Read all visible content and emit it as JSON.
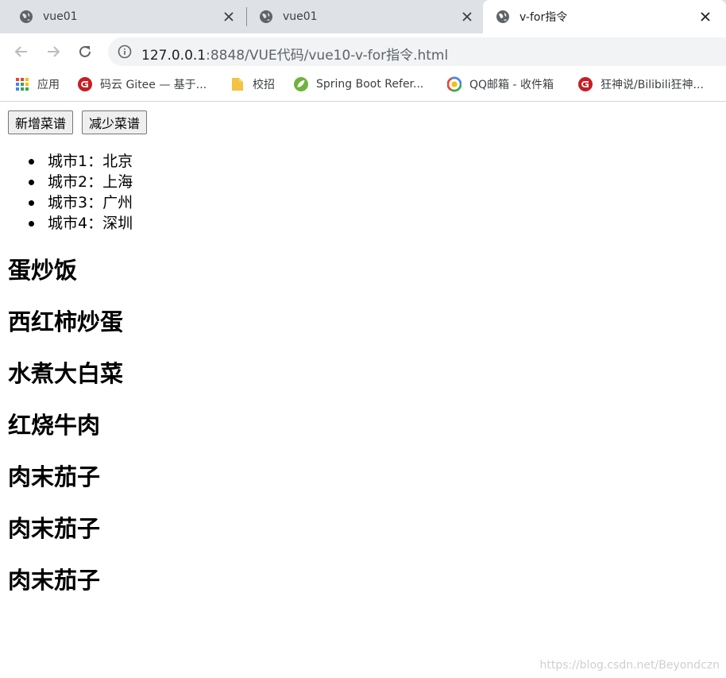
{
  "browser": {
    "tabs": [
      {
        "title": "vue01",
        "active": false
      },
      {
        "title": "vue01",
        "active": false
      },
      {
        "title": "v-for指令",
        "active": true
      }
    ],
    "url_host": "127.0.0.1",
    "url_rest": ":8848/VUE代码/vue10-v-for指令.html",
    "bookmarks": [
      {
        "label": "应用",
        "icon": "apps-grid-icon"
      },
      {
        "label": "码云 Gitee — 基于...",
        "icon": "gitee-icon"
      },
      {
        "label": "校招",
        "icon": "folder-icon"
      },
      {
        "label": "Spring Boot Refer...",
        "icon": "spring-icon"
      },
      {
        "label": "QQ邮箱 - 收件箱",
        "icon": "qq-mail-icon"
      },
      {
        "label": "狂神说/Bilibili狂神...",
        "icon": "gitee-icon"
      }
    ]
  },
  "page": {
    "add_button": "新增菜谱",
    "remove_button": "减少菜谱",
    "cities": [
      "城市1：北京",
      "城市2：上海",
      "城市3：广州",
      "城市4：深圳"
    ],
    "dishes": [
      "蛋炒饭",
      "西红柿炒蛋",
      "水煮大白菜",
      "红烧牛肉",
      "肉末茄子",
      "肉末茄子",
      "肉末茄子"
    ],
    "watermark": "https://blog.csdn.net/Beyondczn"
  },
  "colors": {
    "tabstrip": "#dee1e6",
    "omnibox": "#f1f3f4",
    "gitee_red": "#c71d23",
    "spring_green": "#6db33f",
    "folder_yellow": "#f5c242"
  }
}
